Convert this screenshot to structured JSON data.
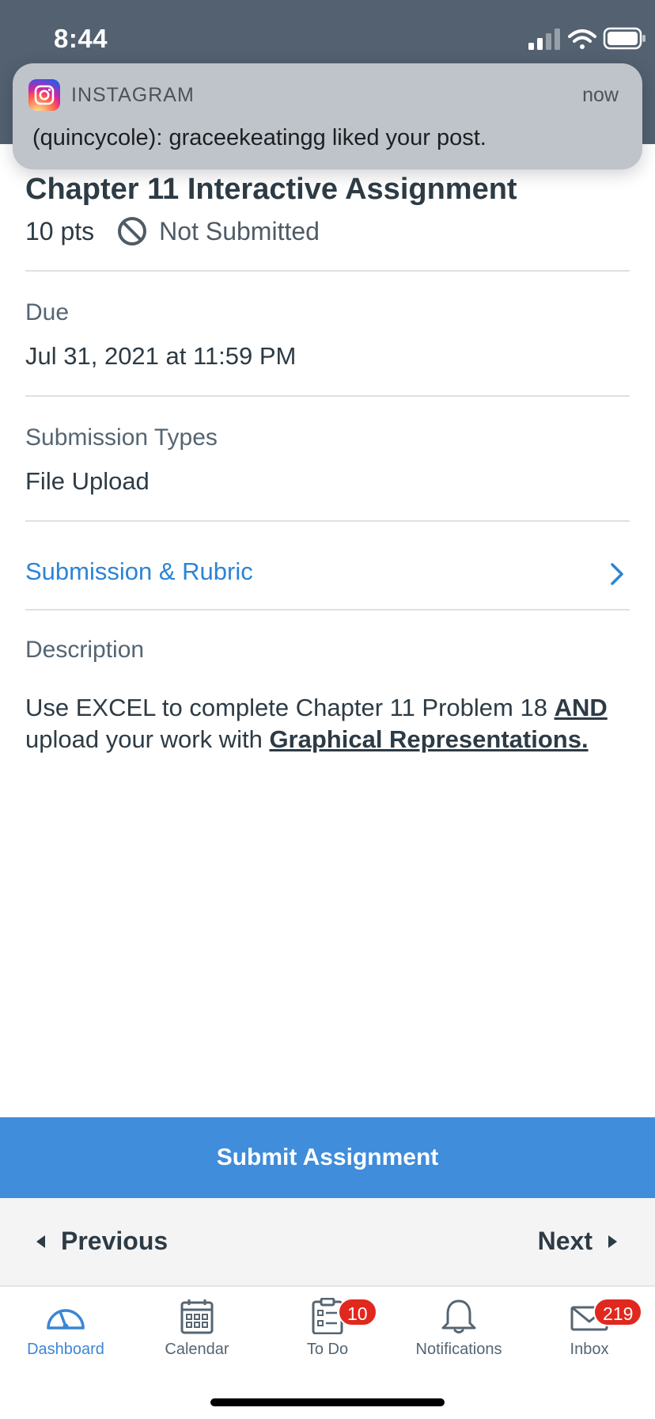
{
  "status_bar": {
    "time": "8:44"
  },
  "notification": {
    "app": "INSTAGRAM",
    "time": "now",
    "message": "(quincycole): graceekeatingg liked your post."
  },
  "assignment": {
    "title": "Chapter 11 Interactive Assignment",
    "points": "10 pts",
    "submission_status": "Not Submitted",
    "due_label": "Due",
    "due_value": "Jul 31, 2021 at 11:59 PM",
    "submission_types_label": "Submission Types",
    "submission_types_value": "File Upload",
    "rubric_link": "Submission & Rubric",
    "description_label": "Description",
    "description": {
      "part1": "Use EXCEL to complete Chapter 11 Problem 18 ",
      "strong1": "AND",
      "part2": " upload your work with ",
      "strong2": "Graphical Representations."
    }
  },
  "actions": {
    "submit": "Submit Assignment"
  },
  "pager": {
    "previous": "Previous",
    "next": "Next"
  },
  "tabbar": {
    "items": [
      {
        "label": "Dashboard",
        "icon": "dashboard-icon",
        "active": true
      },
      {
        "label": "Calendar",
        "icon": "calendar-icon"
      },
      {
        "label": "To Do",
        "icon": "todo-icon",
        "badge": "10"
      },
      {
        "label": "Notifications",
        "icon": "bell-icon"
      },
      {
        "label": "Inbox",
        "icon": "envelope-icon",
        "badge": "219"
      }
    ]
  },
  "colors": {
    "accent": "#3f8ddb",
    "link": "#2b84d6",
    "header": "#536170",
    "badge": "#e0281f"
  }
}
